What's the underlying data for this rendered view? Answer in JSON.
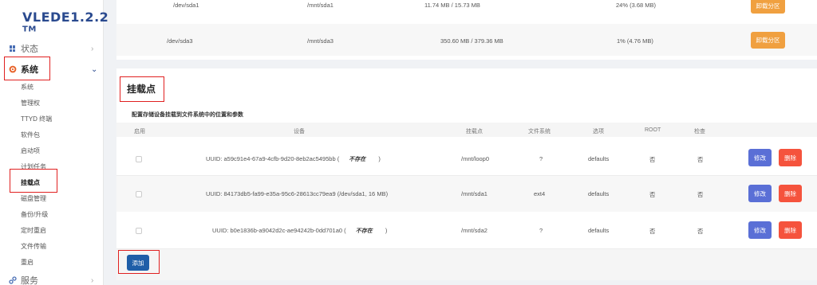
{
  "logo": {
    "name": "VLEDE1.2.2",
    "tm": "TM"
  },
  "sidebar": {
    "status": "状态",
    "system": "系统",
    "services": "服务",
    "sub_items": [
      "系统",
      "管理权",
      "TTYD 终端",
      "软件包",
      "启动项",
      "计划任务",
      "挂载点",
      "磁盘管理",
      "备份/升级",
      "定时重启",
      "文件传输",
      "重启"
    ]
  },
  "partitions": [
    {
      "device": "/dev/sda1",
      "mount": "/mnt/sda1",
      "size": "11.74 MB / 15.73 MB",
      "usage": "24% (3.68 MB)",
      "button": "卸载分区"
    },
    {
      "device": "/dev/sda3",
      "mount": "/mnt/sda3",
      "size": "350.60 MB / 379.36 MB",
      "usage": "1% (4.76 MB)",
      "button": "卸载分区"
    }
  ],
  "mounts": {
    "title": "挂载点",
    "description": "配置存储设备挂载到文件系统中的位置和参数",
    "headers": {
      "enabled": "启用",
      "device": "设备",
      "mountpoint": "挂载点",
      "filesystem": "文件系统",
      "options": "选项",
      "root": "ROOT",
      "check": "检查"
    },
    "rows": [
      {
        "device": "UUID: a59c91e4-67a9-4cfb-9d20-8eb2ac5495bb (",
        "not_exist": "不存在",
        "close": ")",
        "mount": "/mnt/loop0",
        "fs": "?",
        "options": "defaults",
        "root": "否",
        "check": "否",
        "edit": "修改",
        "delete": "删除"
      },
      {
        "device": "UUID: 84173db5-fa99-e35a-95c6-28613cc79ea9 (/dev/sda1, 16 MB)",
        "not_exist": "",
        "close": "",
        "mount": "/mnt/sda1",
        "fs": "ext4",
        "options": "defaults",
        "root": "否",
        "check": "否",
        "edit": "修改",
        "delete": "删除"
      },
      {
        "device": "UUID: b0e1836b-a9042d2c-ae94242b-0dd701a0 (",
        "not_exist": "不存在",
        "close": ")",
        "mount": "/mnt/sda2",
        "fs": "?",
        "options": "defaults",
        "root": "否",
        "check": "否",
        "edit": "修改",
        "delete": "删除"
      }
    ],
    "add_button": "添加"
  },
  "colors": {
    "brand": "#2a4a8f",
    "highlight": "#e02020",
    "orange": "#f0a040",
    "blue": "#5a6fd6",
    "red": "#f5533d"
  }
}
